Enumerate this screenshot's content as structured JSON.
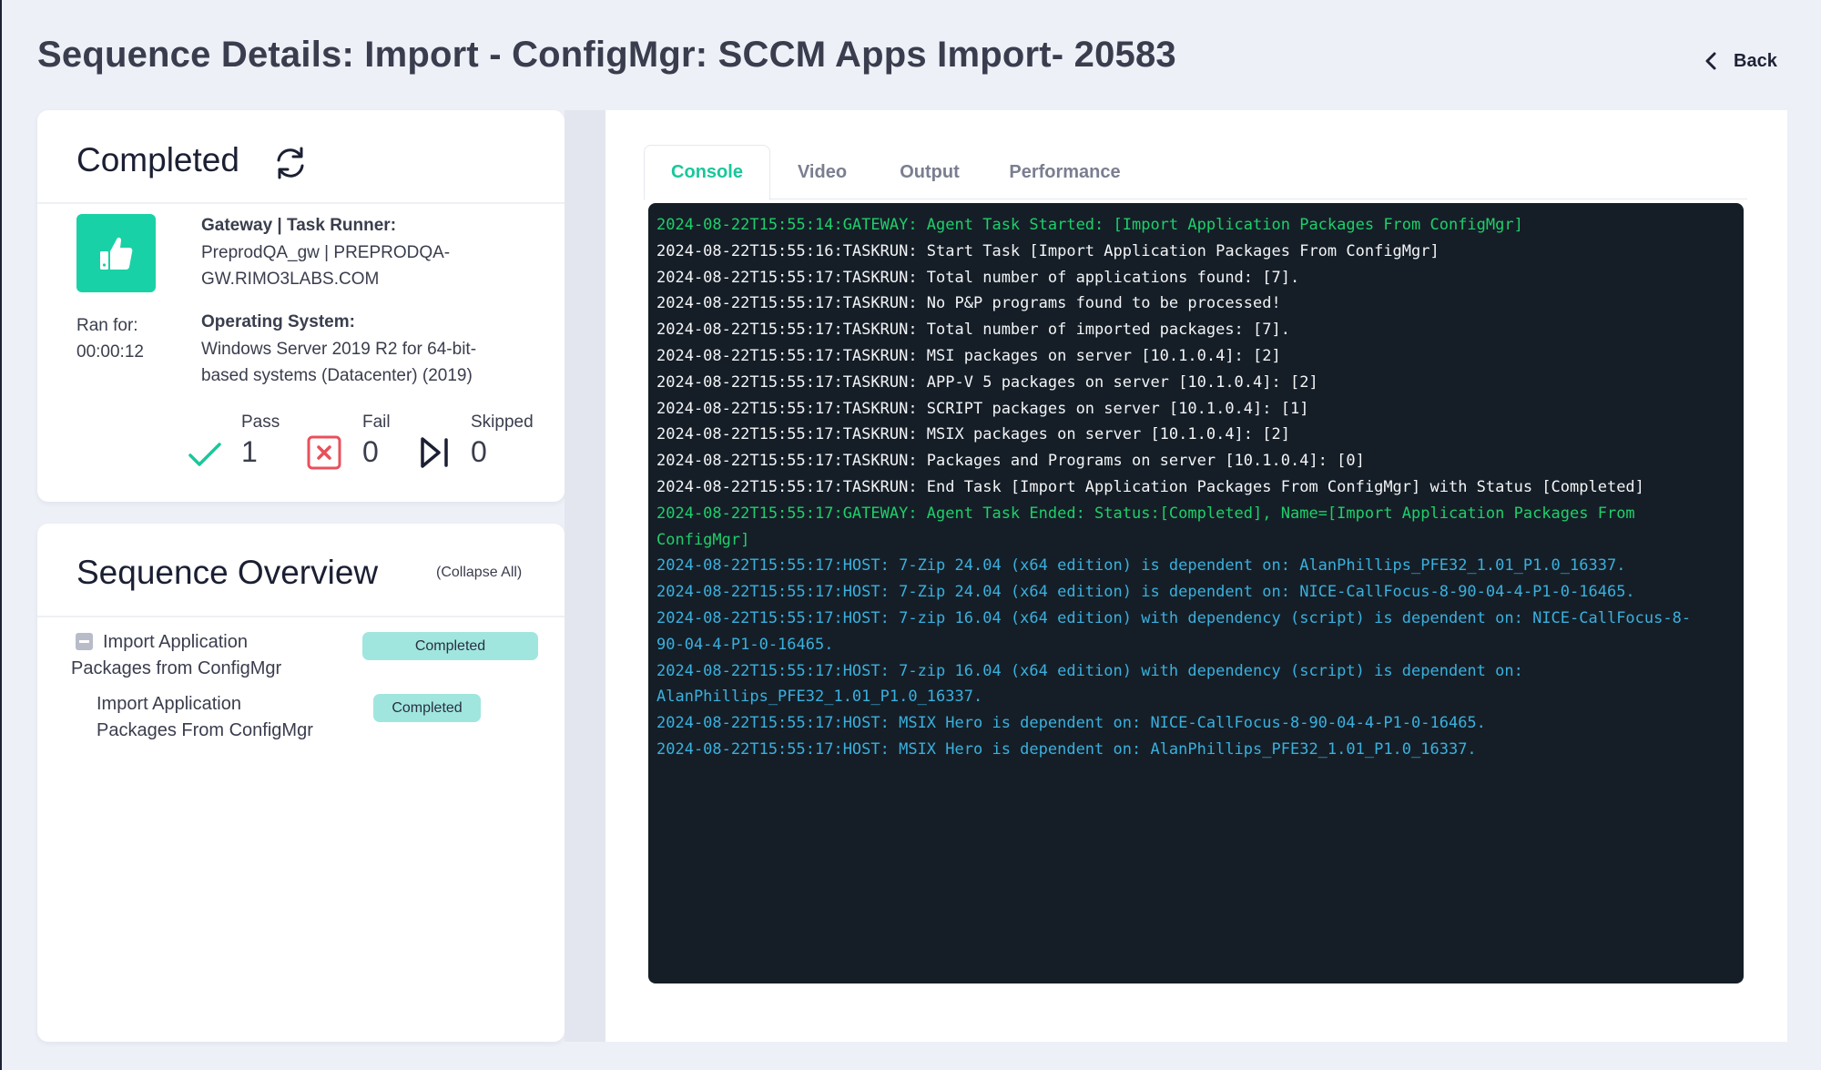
{
  "header": {
    "title": "Sequence Details: Import - ConfigMgr: SCCM Apps Import- 20583",
    "back_label": "Back"
  },
  "status_card": {
    "status": "Completed",
    "gateway_label": "Gateway | Task Runner:",
    "gateway_value_line1": "PreprodQA_gw | PREPRODQA-",
    "gateway_value_line2": "GW.RIMO3LABS.COM",
    "ran_for_label": "Ran for:",
    "ran_for_value": "00:00:12",
    "os_label": "Operating System:",
    "os_value_line1": "Windows Server 2019 R2 for 64-bit-",
    "os_value_line2": "based systems (Datacenter) (2019)",
    "stats": {
      "pass_label": "Pass",
      "pass_value": "1",
      "fail_label": "Fail",
      "fail_value": "0",
      "skipped_label": "Skipped",
      "skipped_value": "0"
    }
  },
  "overview": {
    "title": "Sequence Overview",
    "collapse_all": "(Collapse All)",
    "items": [
      {
        "label_line1": "Import Application",
        "label_line2": "Packages from ConfigMgr",
        "status": "Completed"
      },
      {
        "label_line1": "Import Application",
        "label_line2": "Packages From ConfigMgr",
        "status": "Completed"
      }
    ]
  },
  "tabs": [
    {
      "label": "Console",
      "active": true
    },
    {
      "label": "Video",
      "active": false
    },
    {
      "label": "Output",
      "active": false
    },
    {
      "label": "Performance",
      "active": false
    }
  ],
  "colors": {
    "accent": "#19d1a6",
    "console_bg": "#151e27",
    "log_gateway": "#1fcf6a",
    "log_taskrun": "#f3f4f6",
    "log_host": "#3ab0de",
    "badge": "#a0e6df",
    "fail": "#e8505b"
  },
  "console": {
    "lines": [
      {
        "type": "gateway",
        "text": "2024-08-22T15:55:14:GATEWAY: Agent Task Started: [Import Application Packages From ConfigMgr]"
      },
      {
        "type": "task",
        "text": "2024-08-22T15:55:16:TASKRUN: Start Task [Import Application Packages From ConfigMgr]"
      },
      {
        "type": "task",
        "text": "2024-08-22T15:55:17:TASKRUN: Total number of applications found: [7]."
      },
      {
        "type": "task",
        "text": "2024-08-22T15:55:17:TASKRUN: No P&P programs found to be processed!"
      },
      {
        "type": "task",
        "text": "2024-08-22T15:55:17:TASKRUN: Total number of imported packages: [7]."
      },
      {
        "type": "task",
        "text": "2024-08-22T15:55:17:TASKRUN: MSI packages on server [10.1.0.4]: [2]"
      },
      {
        "type": "task",
        "text": "2024-08-22T15:55:17:TASKRUN: APP-V 5 packages on server [10.1.0.4]: [2]"
      },
      {
        "type": "task",
        "text": "2024-08-22T15:55:17:TASKRUN: SCRIPT packages on server [10.1.0.4]: [1]"
      },
      {
        "type": "task",
        "text": "2024-08-22T15:55:17:TASKRUN: MSIX packages on server [10.1.0.4]: [2]"
      },
      {
        "type": "task",
        "text": "2024-08-22T15:55:17:TASKRUN: Packages and Programs on server [10.1.0.4]: [0]"
      },
      {
        "type": "task",
        "text": "2024-08-22T15:55:17:TASKRUN: End Task [Import Application Packages From ConfigMgr] with Status [Completed]"
      },
      {
        "type": "gateway",
        "text": "2024-08-22T15:55:17:GATEWAY: Agent Task Ended: Status:[Completed], Name=[Import Application Packages From\nConfigMgr]"
      },
      {
        "type": "host",
        "text": "2024-08-22T15:55:17:HOST: 7-Zip 24.04 (x64 edition) is dependent on: AlanPhillips_PFE32_1.01_P1.0_16337."
      },
      {
        "type": "host",
        "text": "2024-08-22T15:55:17:HOST: 7-Zip 24.04 (x64 edition) is dependent on: NICE-CallFocus-8-90-04-4-P1-0-16465."
      },
      {
        "type": "host",
        "text": "2024-08-22T15:55:17:HOST: 7-zip 16.04 (x64 edition) with dependency (script) is dependent on: NICE-CallFocus-8-\n90-04-4-P1-0-16465."
      },
      {
        "type": "host",
        "text": "2024-08-22T15:55:17:HOST: 7-zip 16.04 (x64 edition) with dependency (script) is dependent on:\nAlanPhillips_PFE32_1.01_P1.0_16337."
      },
      {
        "type": "host",
        "text": "2024-08-22T15:55:17:HOST: MSIX Hero is dependent on: NICE-CallFocus-8-90-04-4-P1-0-16465."
      },
      {
        "type": "host",
        "text": "2024-08-22T15:55:17:HOST: MSIX Hero is dependent on: AlanPhillips_PFE32_1.01_P1.0_16337."
      }
    ]
  }
}
